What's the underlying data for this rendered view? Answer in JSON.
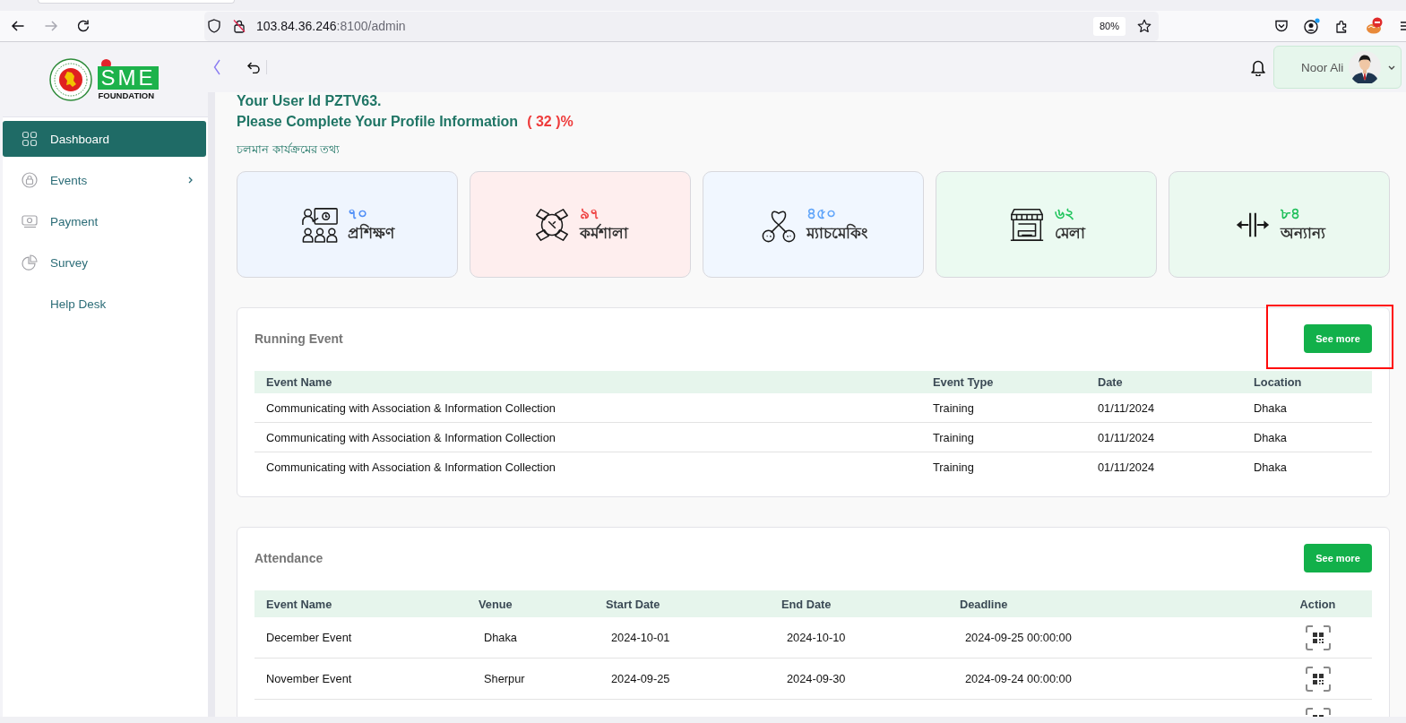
{
  "browser": {
    "address_host": "103.84.36.246",
    "address_path": ":8100/admin",
    "zoom": "80%",
    "forward_disabled": true
  },
  "sidebar": {
    "logo": {
      "name": "SME",
      "tagline": "FOUNDATION"
    },
    "items": [
      {
        "label": "Dashboard",
        "selected": true,
        "expandable": false
      },
      {
        "label": "Events",
        "selected": false,
        "expandable": true
      },
      {
        "label": "Payment",
        "selected": false,
        "expandable": false
      },
      {
        "label": "Survey",
        "selected": false,
        "expandable": false
      },
      {
        "label": "Help Desk",
        "selected": false,
        "expandable": false
      }
    ]
  },
  "header": {
    "user_name": "Noor Ali"
  },
  "profile": {
    "user_id": "Your User Id PZTV63.",
    "prompt": "Please Complete Your Profile Information",
    "completion": "( 32 )%"
  },
  "section_title": "চলমান কার্যক্রমের তথ্য",
  "stat_cards": [
    {
      "count": "৭০",
      "label": "প্রশিক্ষণ",
      "color": "#4f8ef7"
    },
    {
      "count": "৯৭",
      "label": "কর্মশালা",
      "color": "#ef4444"
    },
    {
      "count": "৪৫০",
      "label": "ম্যাচমেকিং",
      "color": "#60a5fa"
    },
    {
      "count": "৬২",
      "label": "মেলা",
      "color": "#22c55e"
    },
    {
      "count": "৮৪",
      "label": "অন্যান্য",
      "color": "#1fbf5a"
    }
  ],
  "running_event": {
    "title": "Running Event",
    "button": "See more",
    "button_highlighted": true,
    "columns": [
      "Event Name",
      "Event Type",
      "Date",
      "Location"
    ],
    "rows": [
      [
        "Communicating with Association & Information Collection",
        "Training",
        "01/11/2024",
        "Dhaka"
      ],
      [
        "Communicating with Association & Information Collection",
        "Training",
        "01/11/2024",
        "Dhaka"
      ],
      [
        "Communicating with Association & Information Collection",
        "Training",
        "01/11/2024",
        "Dhaka"
      ]
    ]
  },
  "attendance": {
    "title": "Attendance",
    "button": "See more",
    "columns": [
      "Event Name",
      "Venue",
      "Start Date",
      "End Date",
      "Deadline",
      "Action"
    ],
    "rows": [
      {
        "cells": [
          "December Event",
          "Dhaka",
          "2024-10-01",
          "2024-10-10",
          "2024-09-25 00:00:00"
        ],
        "qr": true
      },
      {
        "cells": [
          "November Event",
          "Sherpur",
          "2024-09-25",
          "2024-09-30",
          "2024-09-24 00:00:00"
        ],
        "qr": true
      },
      {
        "qr": true
      }
    ]
  }
}
